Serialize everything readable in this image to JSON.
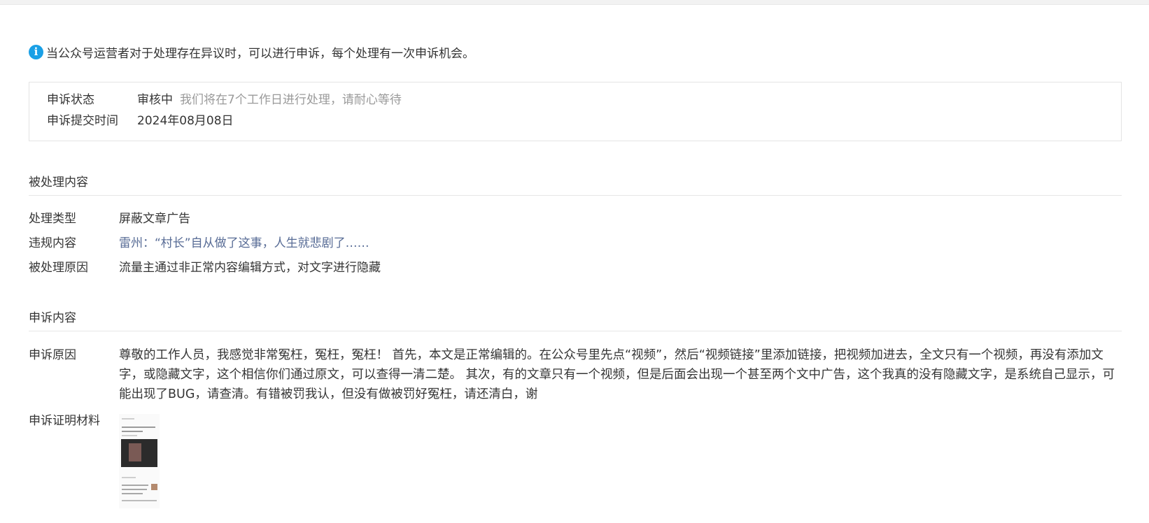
{
  "notice": {
    "icon": "info-icon",
    "text": "当公众号运营者对于处理存在异议时，可以进行申诉，每个处理有一次申诉机会。"
  },
  "status": {
    "state_label": "申诉状态",
    "state_value": "审核中",
    "state_hint": "我们将在7个工作日进行处理，请耐心等待",
    "time_label": "申诉提交时间",
    "time_value": "2024年08月08日"
  },
  "processed": {
    "title": "被处理内容",
    "type_label": "处理类型",
    "type_value": "屏蔽文章广告",
    "content_label": "违规内容",
    "content_value": "雷州：“村长”自从做了这事，人生就悲剧了……",
    "reason_label": "被处理原因",
    "reason_value": "流量主通过非正常内容编辑方式，对文字进行隐藏"
  },
  "appeal": {
    "title": "申诉内容",
    "reason_label": "申诉原因",
    "reason_value": "尊敬的工作人员，我感觉非常冤枉，冤枉，冤枉！ 首先，本文是正常编辑的。在公众号里先点“视频”，然后“视频链接”里添加链接，把视频加进去，全文只有一个视频，再没有添加文字，或隐藏文字，这个相信你们通过原文，可以查得一清二楚。 其次，有的文章只有一个视频，但是后面会出现一个甚至两个文中广告，这个我真的没有隐藏文字，是系统自己显示，可能出现了BUG，请查清。有错被罚我认，但没有做被罚好冤枉，请还清白，谢",
    "evidence_label": "申诉证明材料"
  }
}
